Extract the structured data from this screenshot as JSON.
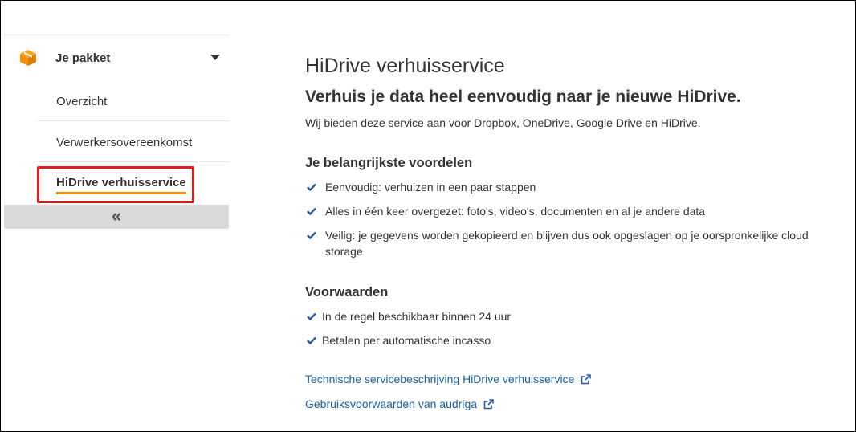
{
  "sidebar": {
    "package_label": "Je pakket",
    "items": [
      {
        "label": "Overzicht"
      },
      {
        "label": "Verwerkersovereenkomst"
      },
      {
        "label": "HiDrive verhuisservice",
        "active": true
      }
    ],
    "collapse_icon": "«",
    "colors": {
      "accent": "#f39200",
      "highlight": "#e31d1d",
      "collapse_bg": "#d9d9d9"
    }
  },
  "main": {
    "title": "HiDrive verhuisservice",
    "subtitle": "Verhuis je data heel eenvoudig naar je nieuwe HiDrive.",
    "intro": "Wij bieden deze service aan voor Dropbox, OneDrive, Google Drive en HiDrive.",
    "benefits": {
      "heading": "Je belangrijkste voordelen",
      "items": [
        "Eenvoudig: verhuizen in een paar stappen",
        "Alles in één keer overgezet: foto's, video's, documenten en al je andere data",
        "Veilig: je gegevens worden gekopieerd en blijven dus ook opgeslagen op je oorspronkelijke cloud storage"
      ]
    },
    "conditions": {
      "heading": "Voorwaarden",
      "items": [
        "In de regel beschikbaar binnen 24 uur",
        "Betalen per automatische incasso"
      ]
    },
    "links": [
      {
        "label": "Technische servicebeschrijving HiDrive verhuisservice",
        "icon": "external-link-icon"
      },
      {
        "label": "Gebruiksvoorwaarden van audriga",
        "icon": "external-link-icon"
      }
    ],
    "colors": {
      "check": "#1d5fa8",
      "link": "#1d5fa8"
    }
  }
}
